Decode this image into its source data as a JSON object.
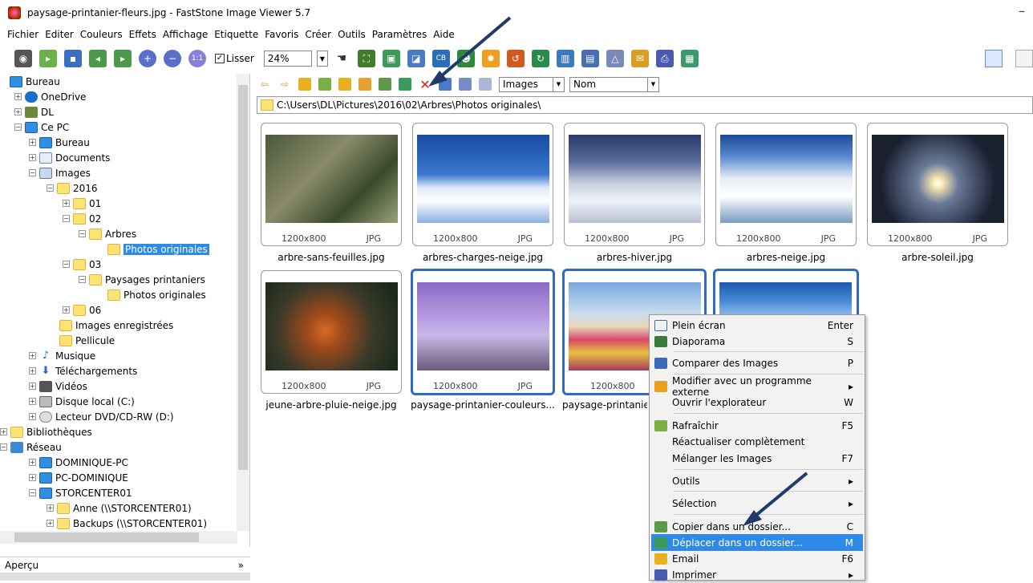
{
  "window": {
    "title": "paysage-printanier-fleurs.jpg  -  FastStone Image Viewer 5.7",
    "minimize": "–"
  },
  "menu": [
    "Fichier",
    "Editer",
    "Couleurs",
    "Effets",
    "Affichage",
    "Etiquette",
    "Favoris",
    "Créer",
    "Outils",
    "Paramètres",
    "Aide"
  ],
  "toolbar": {
    "smooth_label": "Lisser",
    "smooth_checked": "✓",
    "zoom_value": "24%"
  },
  "tree": {
    "items": [
      {
        "label": "Bureau"
      },
      {
        "label": "OneDrive"
      },
      {
        "label": "DL"
      },
      {
        "label": "Ce PC"
      },
      {
        "label": "Bureau"
      },
      {
        "label": "Documents"
      },
      {
        "label": "Images"
      },
      {
        "label": "2016"
      },
      {
        "label": "01"
      },
      {
        "label": "02"
      },
      {
        "label": "Arbres"
      },
      {
        "label": "Photos originales"
      },
      {
        "label": "03"
      },
      {
        "label": "Paysages printaniers"
      },
      {
        "label": "Photos originales"
      },
      {
        "label": "06"
      },
      {
        "label": "Images enregistrées"
      },
      {
        "label": "Pellicule"
      },
      {
        "label": "Musique"
      },
      {
        "label": "Téléchargements"
      },
      {
        "label": "Vidéos"
      },
      {
        "label": "Disque local (C:)"
      },
      {
        "label": "Lecteur DVD/CD-RW (D:)"
      },
      {
        "label": "Bibliothèques"
      },
      {
        "label": "Réseau"
      },
      {
        "label": "DOMINIQUE-PC"
      },
      {
        "label": "PC-DOMINIQUE"
      },
      {
        "label": "STORCENTER01"
      },
      {
        "label": "Anne (\\\\STORCENTER01)"
      },
      {
        "label": "Backups (\\\\STORCENTER01)"
      }
    ]
  },
  "preview": {
    "label": "Aperçu",
    "collapse": "»"
  },
  "browser": {
    "filter": "Images",
    "sort": "Nom",
    "path": "C:\\Users\\DL\\Pictures\\2016\\02\\Arbres\\Photos originales\\"
  },
  "thumbs": [
    {
      "name": "arbre-sans-feuilles.jpg",
      "dims": "1200x800",
      "fmt": "JPG"
    },
    {
      "name": "arbres-charges-neige.jpg",
      "dims": "1200x800",
      "fmt": "JPG"
    },
    {
      "name": "arbres-hiver.jpg",
      "dims": "1200x800",
      "fmt": "JPG"
    },
    {
      "name": "arbres-neige.jpg",
      "dims": "1200x800",
      "fmt": "JPG"
    },
    {
      "name": "arbre-soleil.jpg",
      "dims": "1200x800",
      "fmt": "JPG"
    },
    {
      "name": "jeune-arbre-pluie-neige.jpg",
      "dims": "1200x800",
      "fmt": "JPG"
    },
    {
      "name": "paysage-printanier-couleurs...",
      "dims": "1200x800",
      "fmt": "JPG"
    },
    {
      "name": "paysage-printanie",
      "dims": "1200x800",
      "fmt": ""
    },
    {
      "name": "",
      "dims": "",
      "fmt": ""
    }
  ],
  "context_menu": [
    {
      "label": "Plein écran",
      "shortcut": "Enter"
    },
    {
      "label": "Diaporama",
      "shortcut": "S"
    },
    {
      "label": "Comparer des Images",
      "shortcut": "P"
    },
    {
      "label": "Modifier avec un programme externe",
      "shortcut": "▸"
    },
    {
      "label": "Ouvrir l'explorateur",
      "shortcut": "W"
    },
    {
      "label": "Rafraîchir",
      "shortcut": "F5"
    },
    {
      "label": "Réactualiser complètement",
      "shortcut": ""
    },
    {
      "label": "Mélanger les Images",
      "shortcut": "F7"
    },
    {
      "label": "Outils",
      "shortcut": "▸"
    },
    {
      "label": "Sélection",
      "shortcut": "▸"
    },
    {
      "label": "Copier dans un dossier...",
      "shortcut": "C"
    },
    {
      "label": "Déplacer dans un dossier...",
      "shortcut": "M"
    },
    {
      "label": "Email",
      "shortcut": "F6"
    },
    {
      "label": "Imprimer",
      "shortcut": "▸"
    }
  ]
}
